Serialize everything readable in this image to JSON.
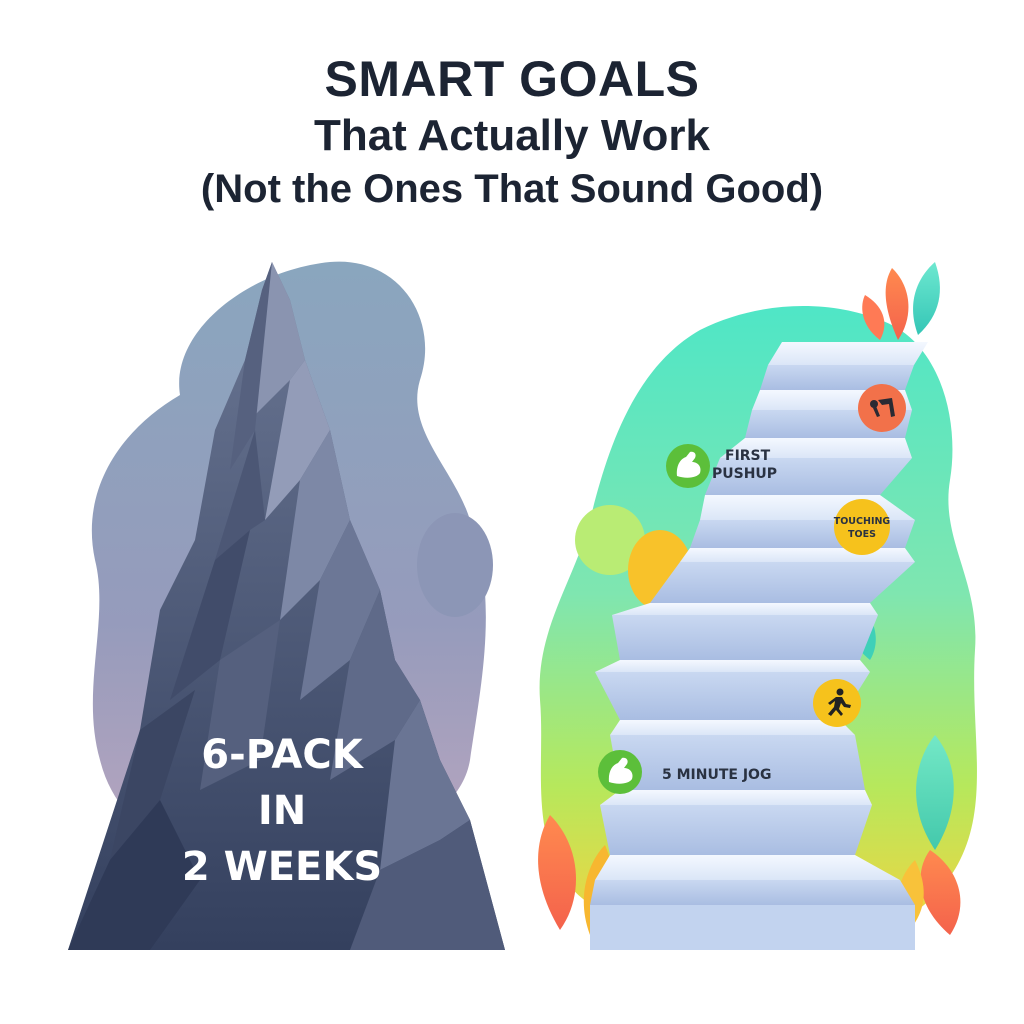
{
  "title": {
    "line1": "SMART GOALS",
    "line2": "That Actually Work",
    "line3": "(Not the Ones That Sound Good)"
  },
  "mountain": {
    "line1": "6-PACK",
    "line2": "IN",
    "line3": "2 WEEKS"
  },
  "staircase": {
    "first_pushup_line1": "FIRST",
    "first_pushup_line2": "PUSHUP",
    "touching_toes_line1": "TOUCHING",
    "touching_toes_line2": "TOES",
    "jog_label": "5 MINUTE JOG"
  },
  "icons": {
    "muscle_top": "flexed-arm-icon",
    "toe_touch": "bending-person-icon",
    "runner": "running-person-icon",
    "muscle_bottom": "flexed-arm-icon"
  },
  "colors": {
    "title": "#1c2433",
    "mountain_dark": "#3a4563",
    "blob_left": "#7f9bb5",
    "green_badge": "#5cbf3a",
    "orange_badge": "#f2714a",
    "yellow_badge": "#f6c21c"
  }
}
